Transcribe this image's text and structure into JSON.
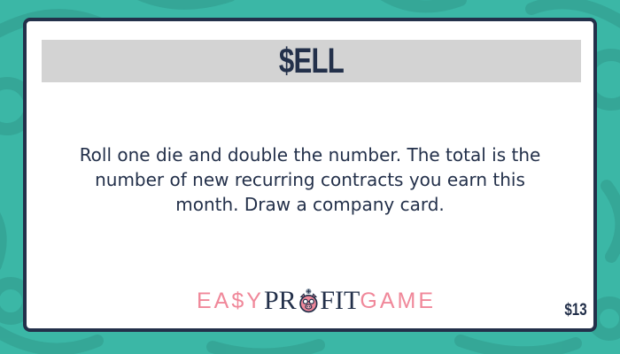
{
  "card": {
    "title": "$ELL",
    "body": "Roll one die and double the number. The total is the number of new recurring contracts you earn this month. Draw a company card.",
    "price": "$13"
  },
  "logo": {
    "part1": "EA$Y",
    "part2": "PR",
    "part3": "FIT",
    "part4": "GAME",
    "icon": "pig-icon"
  },
  "colors": {
    "background": "#3bb7a6",
    "border": "#23304a",
    "title_bar": "#d3d3d3",
    "logo_pink": "#f0889a"
  }
}
